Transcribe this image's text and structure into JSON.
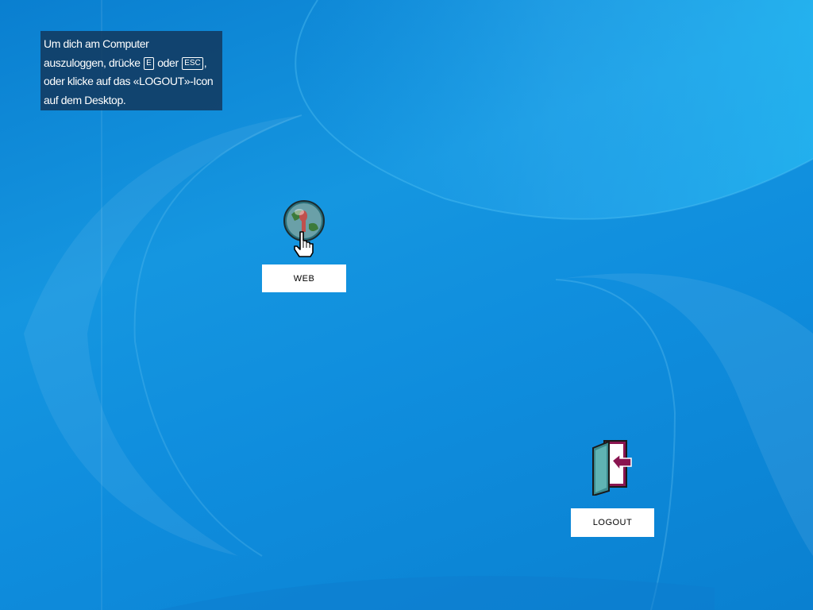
{
  "hint": {
    "line1": "Um dich am Computer",
    "line2_start": "auszuloggen, drücke",
    "key1": "E",
    "line2_mid": "oder",
    "key2": "ESC",
    "line2_end": ",",
    "line3": "oder klicke auf das «LOGOUT»-Icon",
    "line4": "auf dem Desktop."
  },
  "desktop_icons": [
    {
      "label": "WEB",
      "icon": "globe-icon"
    },
    {
      "label": "LOGOUT",
      "icon": "exit-door-icon"
    }
  ],
  "cursor": {
    "icon": "hand-pointer-cursor"
  },
  "colors": {
    "background": "#1596e0",
    "hint_background": "#123458",
    "label_background": "#ffffff",
    "logout_door": "#8a1550"
  }
}
